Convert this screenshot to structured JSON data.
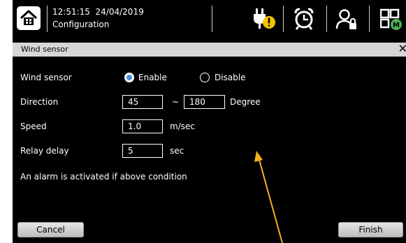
{
  "status_bar": {
    "time": "12:51:15",
    "date": "24/04/2019",
    "screen_name": "Configuration",
    "icons": [
      "home-icon",
      "power-plug-warning-icon",
      "alarm-clock-icon",
      "user-lock-icon",
      "module-grid-icon"
    ],
    "warning_color": "#f2c200",
    "module_badge_color": "#4caf50"
  },
  "dialog": {
    "title": "Wind sensor",
    "close_symbol": "✕",
    "wind_sensor": {
      "label": "Wind sensor",
      "enable_label": "Enable",
      "disable_label": "Disable",
      "selected": "Enable"
    },
    "direction": {
      "label": "Direction",
      "from_value": "45",
      "separator": "~",
      "to_value": "180",
      "unit": "Degree"
    },
    "speed": {
      "label": "Speed",
      "value": "1.0",
      "unit": "m/sec"
    },
    "relay_delay": {
      "label": "Relay delay",
      "value": "5",
      "unit": "sec"
    },
    "note": "An alarm is activated if above condition",
    "cancel_label": "Cancel",
    "finish_label": "Finish",
    "accent_color": "#4a90d9"
  },
  "annotation": {
    "arrow_color": "#f5b21b"
  }
}
